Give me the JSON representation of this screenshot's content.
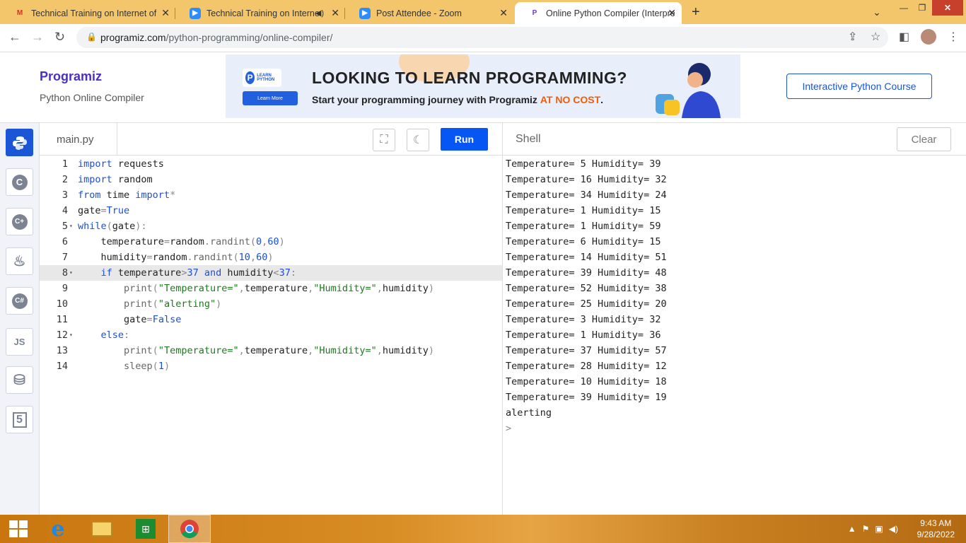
{
  "browser": {
    "tabs": [
      {
        "title": "Technical Training on Internet of",
        "icon": "gmail-icon"
      },
      {
        "title": "Technical Training on Interne",
        "icon": "zoom-icon"
      },
      {
        "title": "Post Attendee - Zoom",
        "icon": "zoom-icon"
      },
      {
        "title": "Online Python Compiler (Interpre",
        "icon": "programiz-icon"
      }
    ],
    "url_host": "programiz.com",
    "url_path": "/python-programming/online-compiler/"
  },
  "header": {
    "logo": "Programiz",
    "subtitle": "Python Online Compiler",
    "banner_badge": "LEARN PYTHON",
    "banner_button": "Learn More",
    "banner_heading": "LOOKING TO LEARN PROGRAMMING?",
    "banner_sub_prefix": "Start your programming journey with Programiz ",
    "banner_sub_highlight": "AT NO COST",
    "banner_sub_suffix": ".",
    "course_button": "Interactive Python Course"
  },
  "sidebar": {
    "items": [
      "python-icon",
      "c-icon",
      "cpp-icon",
      "java-icon",
      "csharp-icon",
      "js-icon",
      "database-icon",
      "html5-icon"
    ],
    "js_label": "JS"
  },
  "editor": {
    "file_tab": "main.py",
    "run_label": "Run",
    "highlighted_line": 8,
    "lines": [
      {
        "n": "1",
        "text": "import requests"
      },
      {
        "n": "2",
        "text": "import random"
      },
      {
        "n": "3",
        "text": "from time import*"
      },
      {
        "n": "4",
        "text": "gate=True"
      },
      {
        "n": "5",
        "text": "while(gate):"
      },
      {
        "n": "6",
        "text": "    temperature=random.randint(0,60)"
      },
      {
        "n": "7",
        "text": "    humidity=random.randint(10,60)"
      },
      {
        "n": "8",
        "text": "    if temperature>37 and humidity<37:"
      },
      {
        "n": "9",
        "text": "        print(\"Temperature=\",temperature,\"Humidity=\",humidity)"
      },
      {
        "n": "10",
        "text": "        print(\"alerting\")"
      },
      {
        "n": "11",
        "text": "        gate=False"
      },
      {
        "n": "12",
        "text": "    else:"
      },
      {
        "n": "13",
        "text": "        print(\"Temperature=\",temperature,\"Humidity=\",humidity)"
      },
      {
        "n": "14",
        "text": "        sleep(1)"
      }
    ]
  },
  "shell": {
    "title": "Shell",
    "clear_label": "Clear",
    "output": [
      "Temperature= 5 Humidity= 39",
      "Temperature= 16 Humidity= 32",
      "Temperature= 34 Humidity= 24",
      "Temperature= 1 Humidity= 15",
      "Temperature= 1 Humidity= 59",
      "Temperature= 6 Humidity= 15",
      "Temperature= 14 Humidity= 51",
      "Temperature= 39 Humidity= 48",
      "Temperature= 52 Humidity= 38",
      "Temperature= 25 Humidity= 20",
      "Temperature= 3 Humidity= 32",
      "Temperature= 1 Humidity= 36",
      "Temperature= 37 Humidity= 57",
      "Temperature= 28 Humidity= 12",
      "Temperature= 10 Humidity= 18",
      "Temperature= 39 Humidity= 19",
      "alerting"
    ],
    "prompt": ">"
  },
  "taskbar": {
    "time": "9:43 AM",
    "date": "9/28/2022"
  }
}
